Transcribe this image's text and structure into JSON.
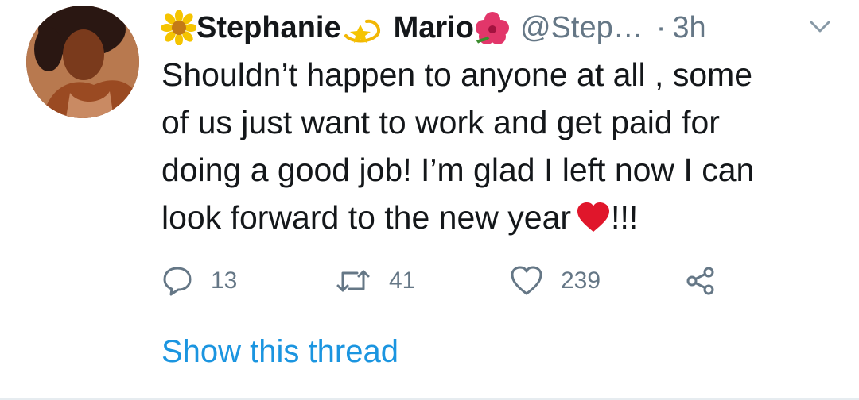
{
  "tweet": {
    "author": {
      "name_part1": "Stephanie",
      "name_part2": "Mario",
      "handle": "@Step…",
      "icons": [
        "sunflower-emoji",
        "dizzy-emoji",
        "hibiscus-emoji"
      ]
    },
    "separator": "·",
    "time": "3h",
    "text_lines": [
      "Shouldn’t happen to anyone at all , some",
      "of us just want to work and get paid for",
      "doing a good job! I’m glad I left now I can",
      "look forward to the  new year"
    ],
    "text_suffix": "!!!",
    "actions": {
      "replies": "13",
      "retweets": "41",
      "likes": "239"
    },
    "show_thread": "Show this thread"
  },
  "colors": {
    "text": "#14171a",
    "muted": "#657786",
    "link": "#1b95e0",
    "heart": "#e0162b"
  }
}
